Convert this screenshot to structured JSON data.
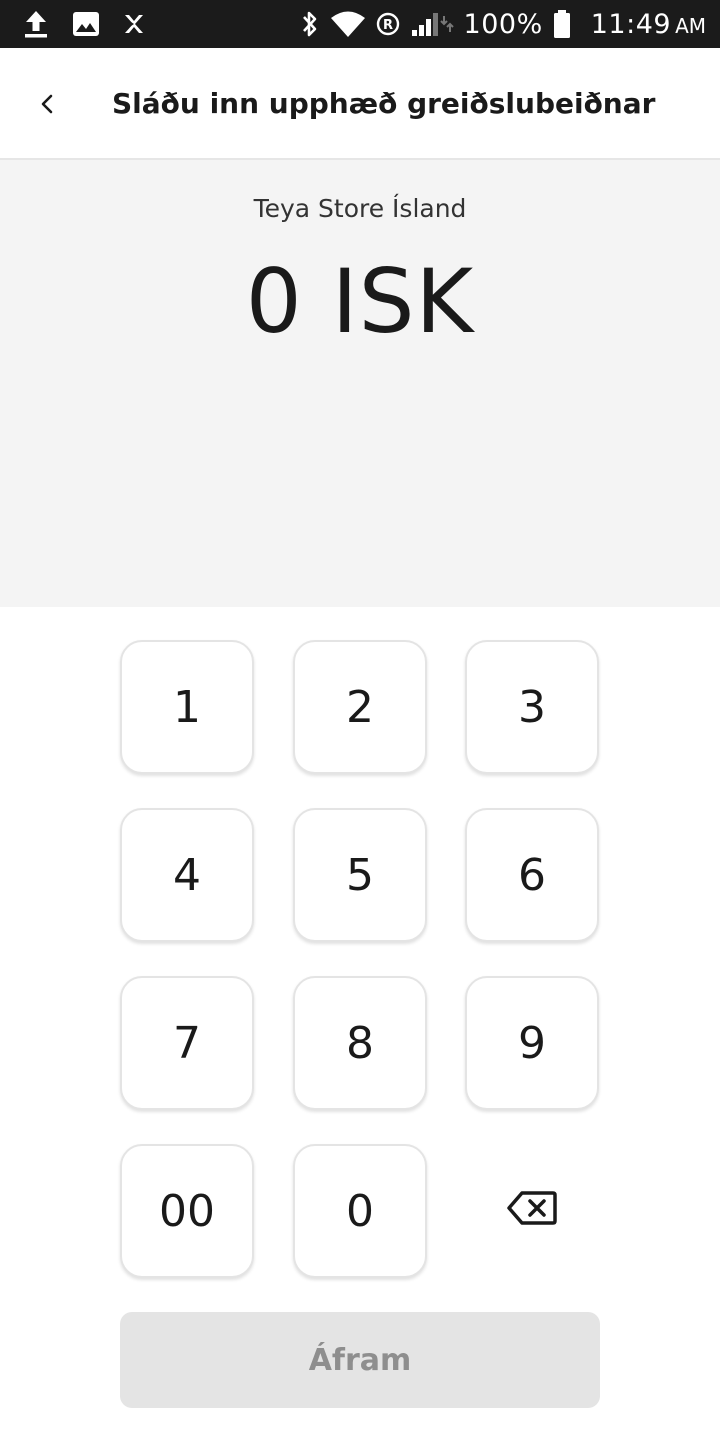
{
  "status_bar": {
    "battery_percent": "100%",
    "time": "11:49",
    "ampm": "AM",
    "icons": [
      "upload-icon",
      "image-icon",
      "app-notification-icon",
      "bluetooth-icon",
      "wifi-icon",
      "roaming-icon",
      "signal-icon",
      "battery-icon"
    ]
  },
  "app_bar": {
    "back_icon": "chevron-left-icon",
    "title": "Sláðu inn upphæð greiðslubeiðnar"
  },
  "amount_panel": {
    "merchant_name": "Teya Store Ísland",
    "amount": "0 ISK"
  },
  "keypad": {
    "keys": [
      "1",
      "2",
      "3",
      "4",
      "5",
      "6",
      "7",
      "8",
      "9",
      "00",
      "0"
    ],
    "backspace_icon": "backspace-icon"
  },
  "continue_button": {
    "label": "Áfram",
    "enabled": false
  },
  "colors": {
    "status_bar_bg": "#1b1b1b",
    "amount_panel_bg": "#f4f4f4",
    "button_disabled_bg": "#e4e4e4",
    "button_disabled_text": "#8e8e8e",
    "text_primary": "#1a1a1a"
  }
}
